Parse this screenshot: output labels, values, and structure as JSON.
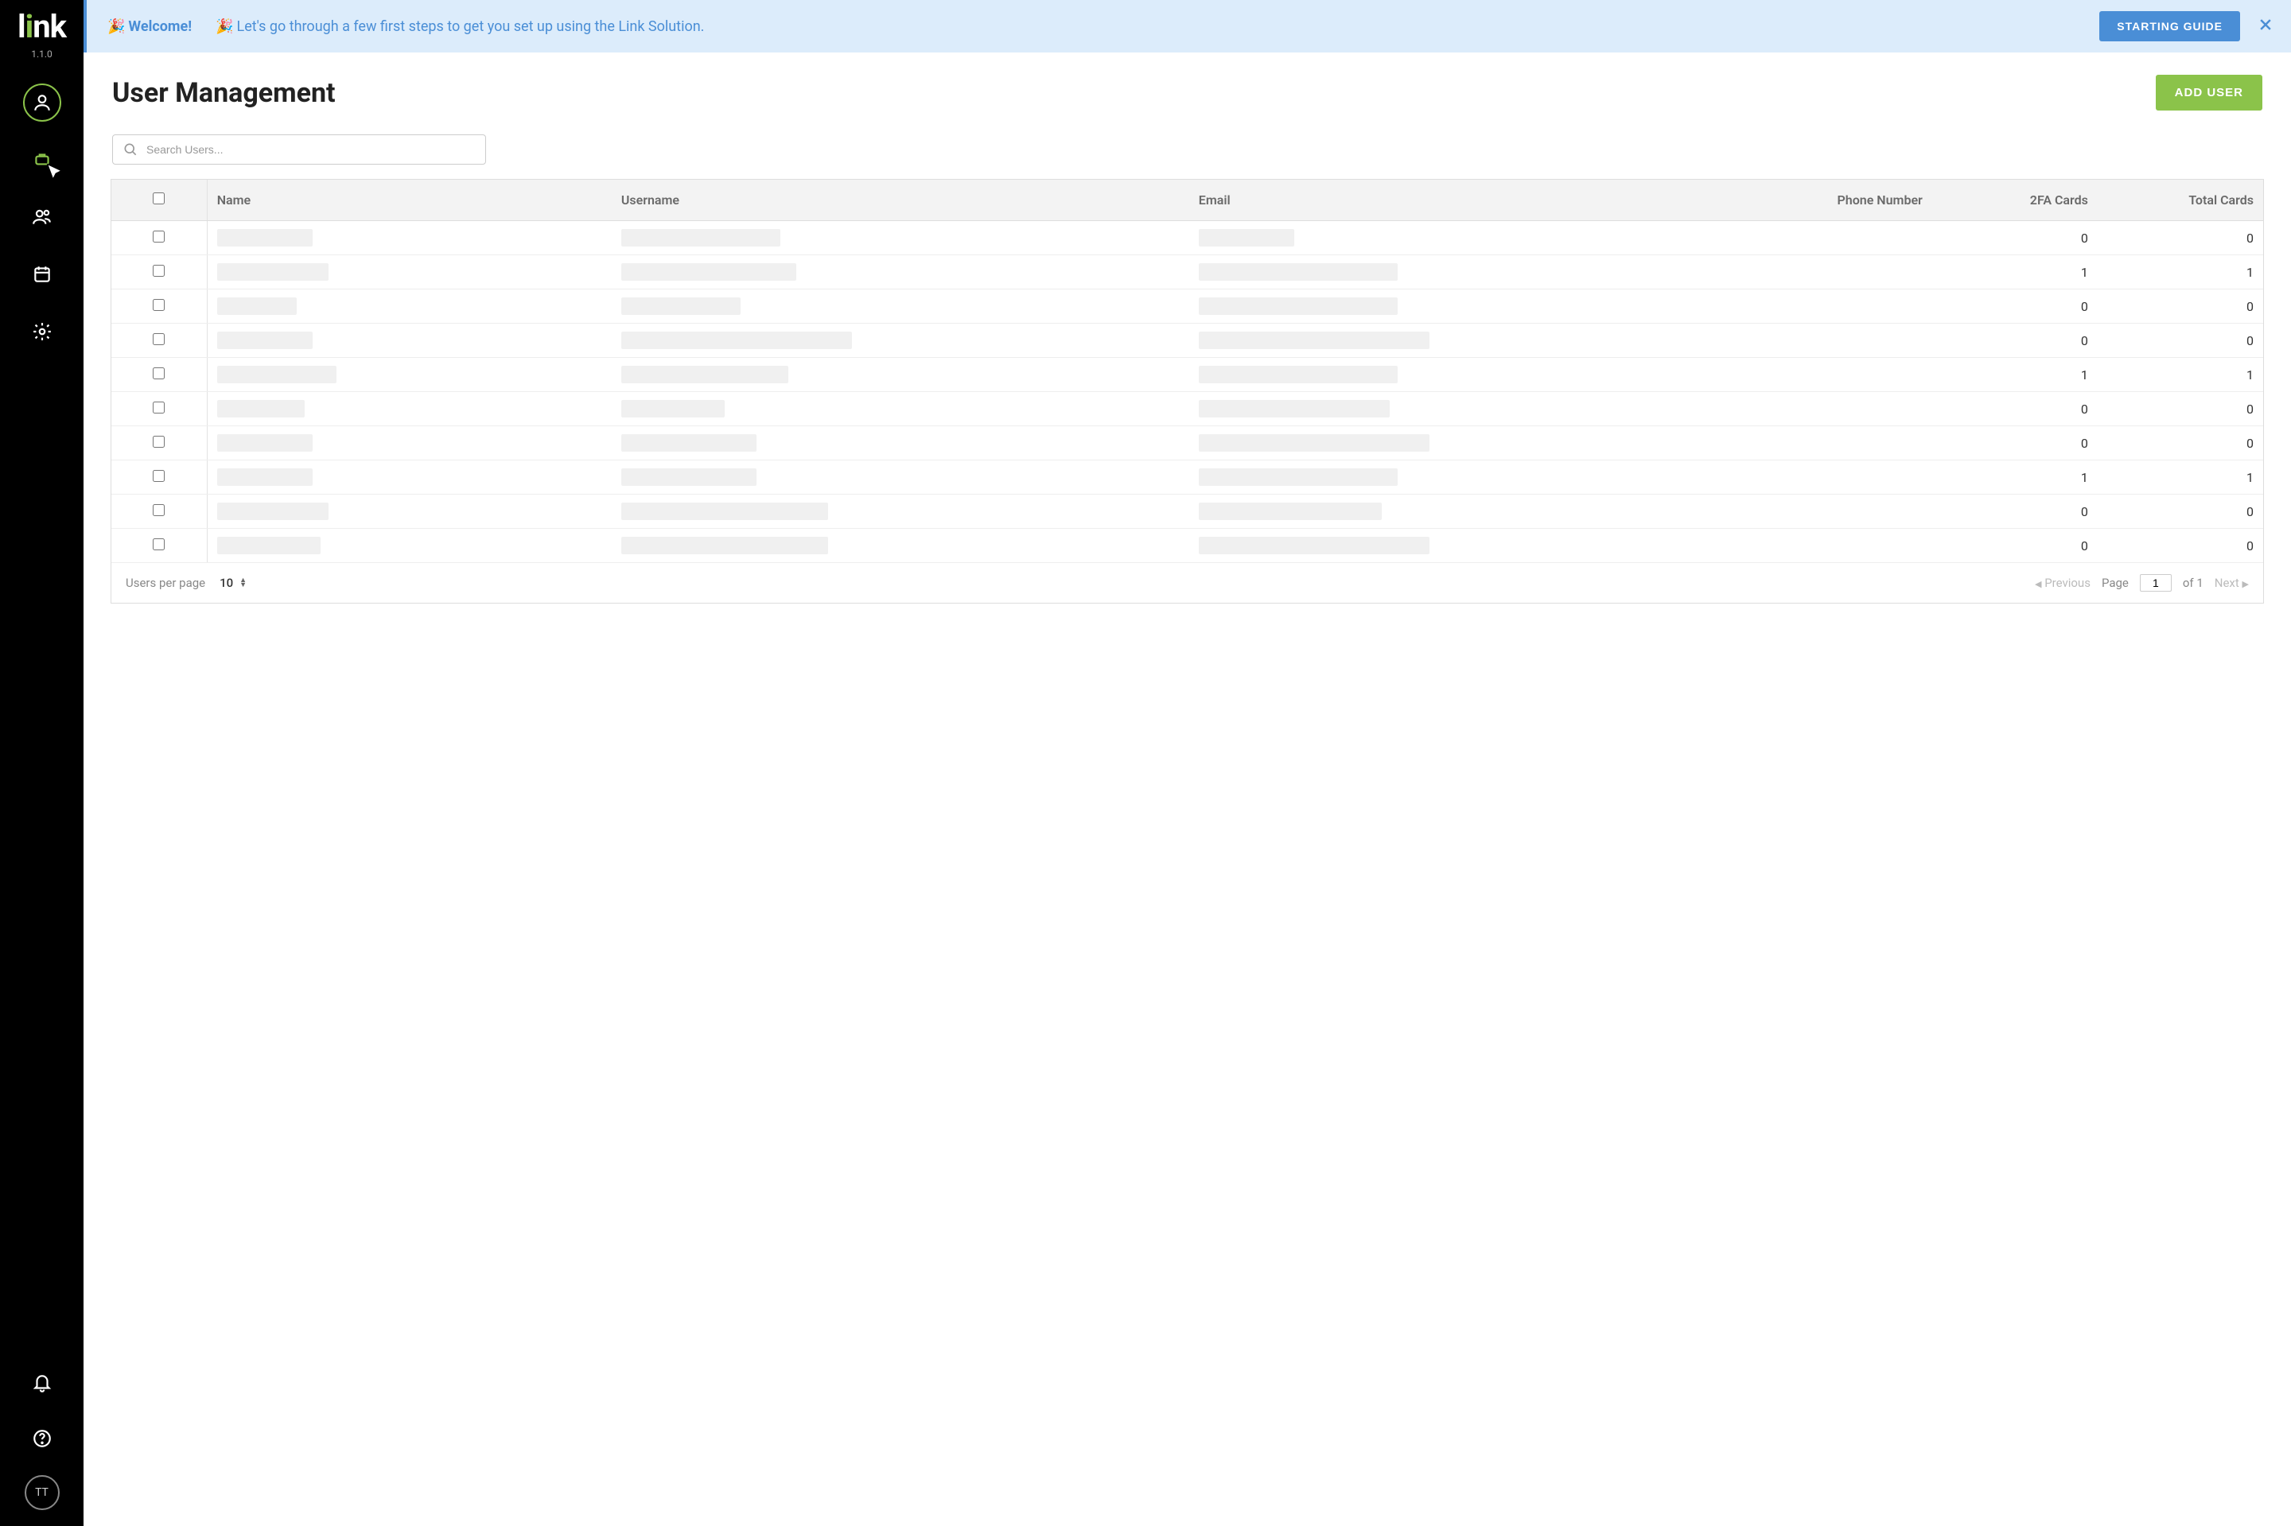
{
  "brand": {
    "name_prefix": "l",
    "name_rest": "nk",
    "version": "1.1.0"
  },
  "banner": {
    "welcome": "Welcome!",
    "text": "Let's go through a few first steps to get you set up using the Link Solution.",
    "button": "STARTING GUIDE"
  },
  "page": {
    "title": "User Management",
    "add_button": "ADD USER"
  },
  "search": {
    "placeholder": "Search Users..."
  },
  "table": {
    "columns": {
      "name": "Name",
      "username": "Username",
      "email": "Email",
      "phone": "Phone Number",
      "twofa": "2FA Cards",
      "total": "Total Cards"
    },
    "rows": [
      {
        "twofa": 0,
        "total": 0
      },
      {
        "twofa": 1,
        "total": 1
      },
      {
        "twofa": 0,
        "total": 0
      },
      {
        "twofa": 0,
        "total": 0
      },
      {
        "twofa": 1,
        "total": 1
      },
      {
        "twofa": 0,
        "total": 0
      },
      {
        "twofa": 0,
        "total": 0
      },
      {
        "twofa": 1,
        "total": 1
      },
      {
        "twofa": 0,
        "total": 0
      },
      {
        "twofa": 0,
        "total": 0
      }
    ]
  },
  "footer": {
    "perpage_label": "Users per page",
    "perpage_value": "10",
    "prev": "Previous",
    "page_label": "Page",
    "page_value": "1",
    "of_label": "of 1",
    "next": "Next"
  },
  "avatar": {
    "initials": "TT"
  }
}
